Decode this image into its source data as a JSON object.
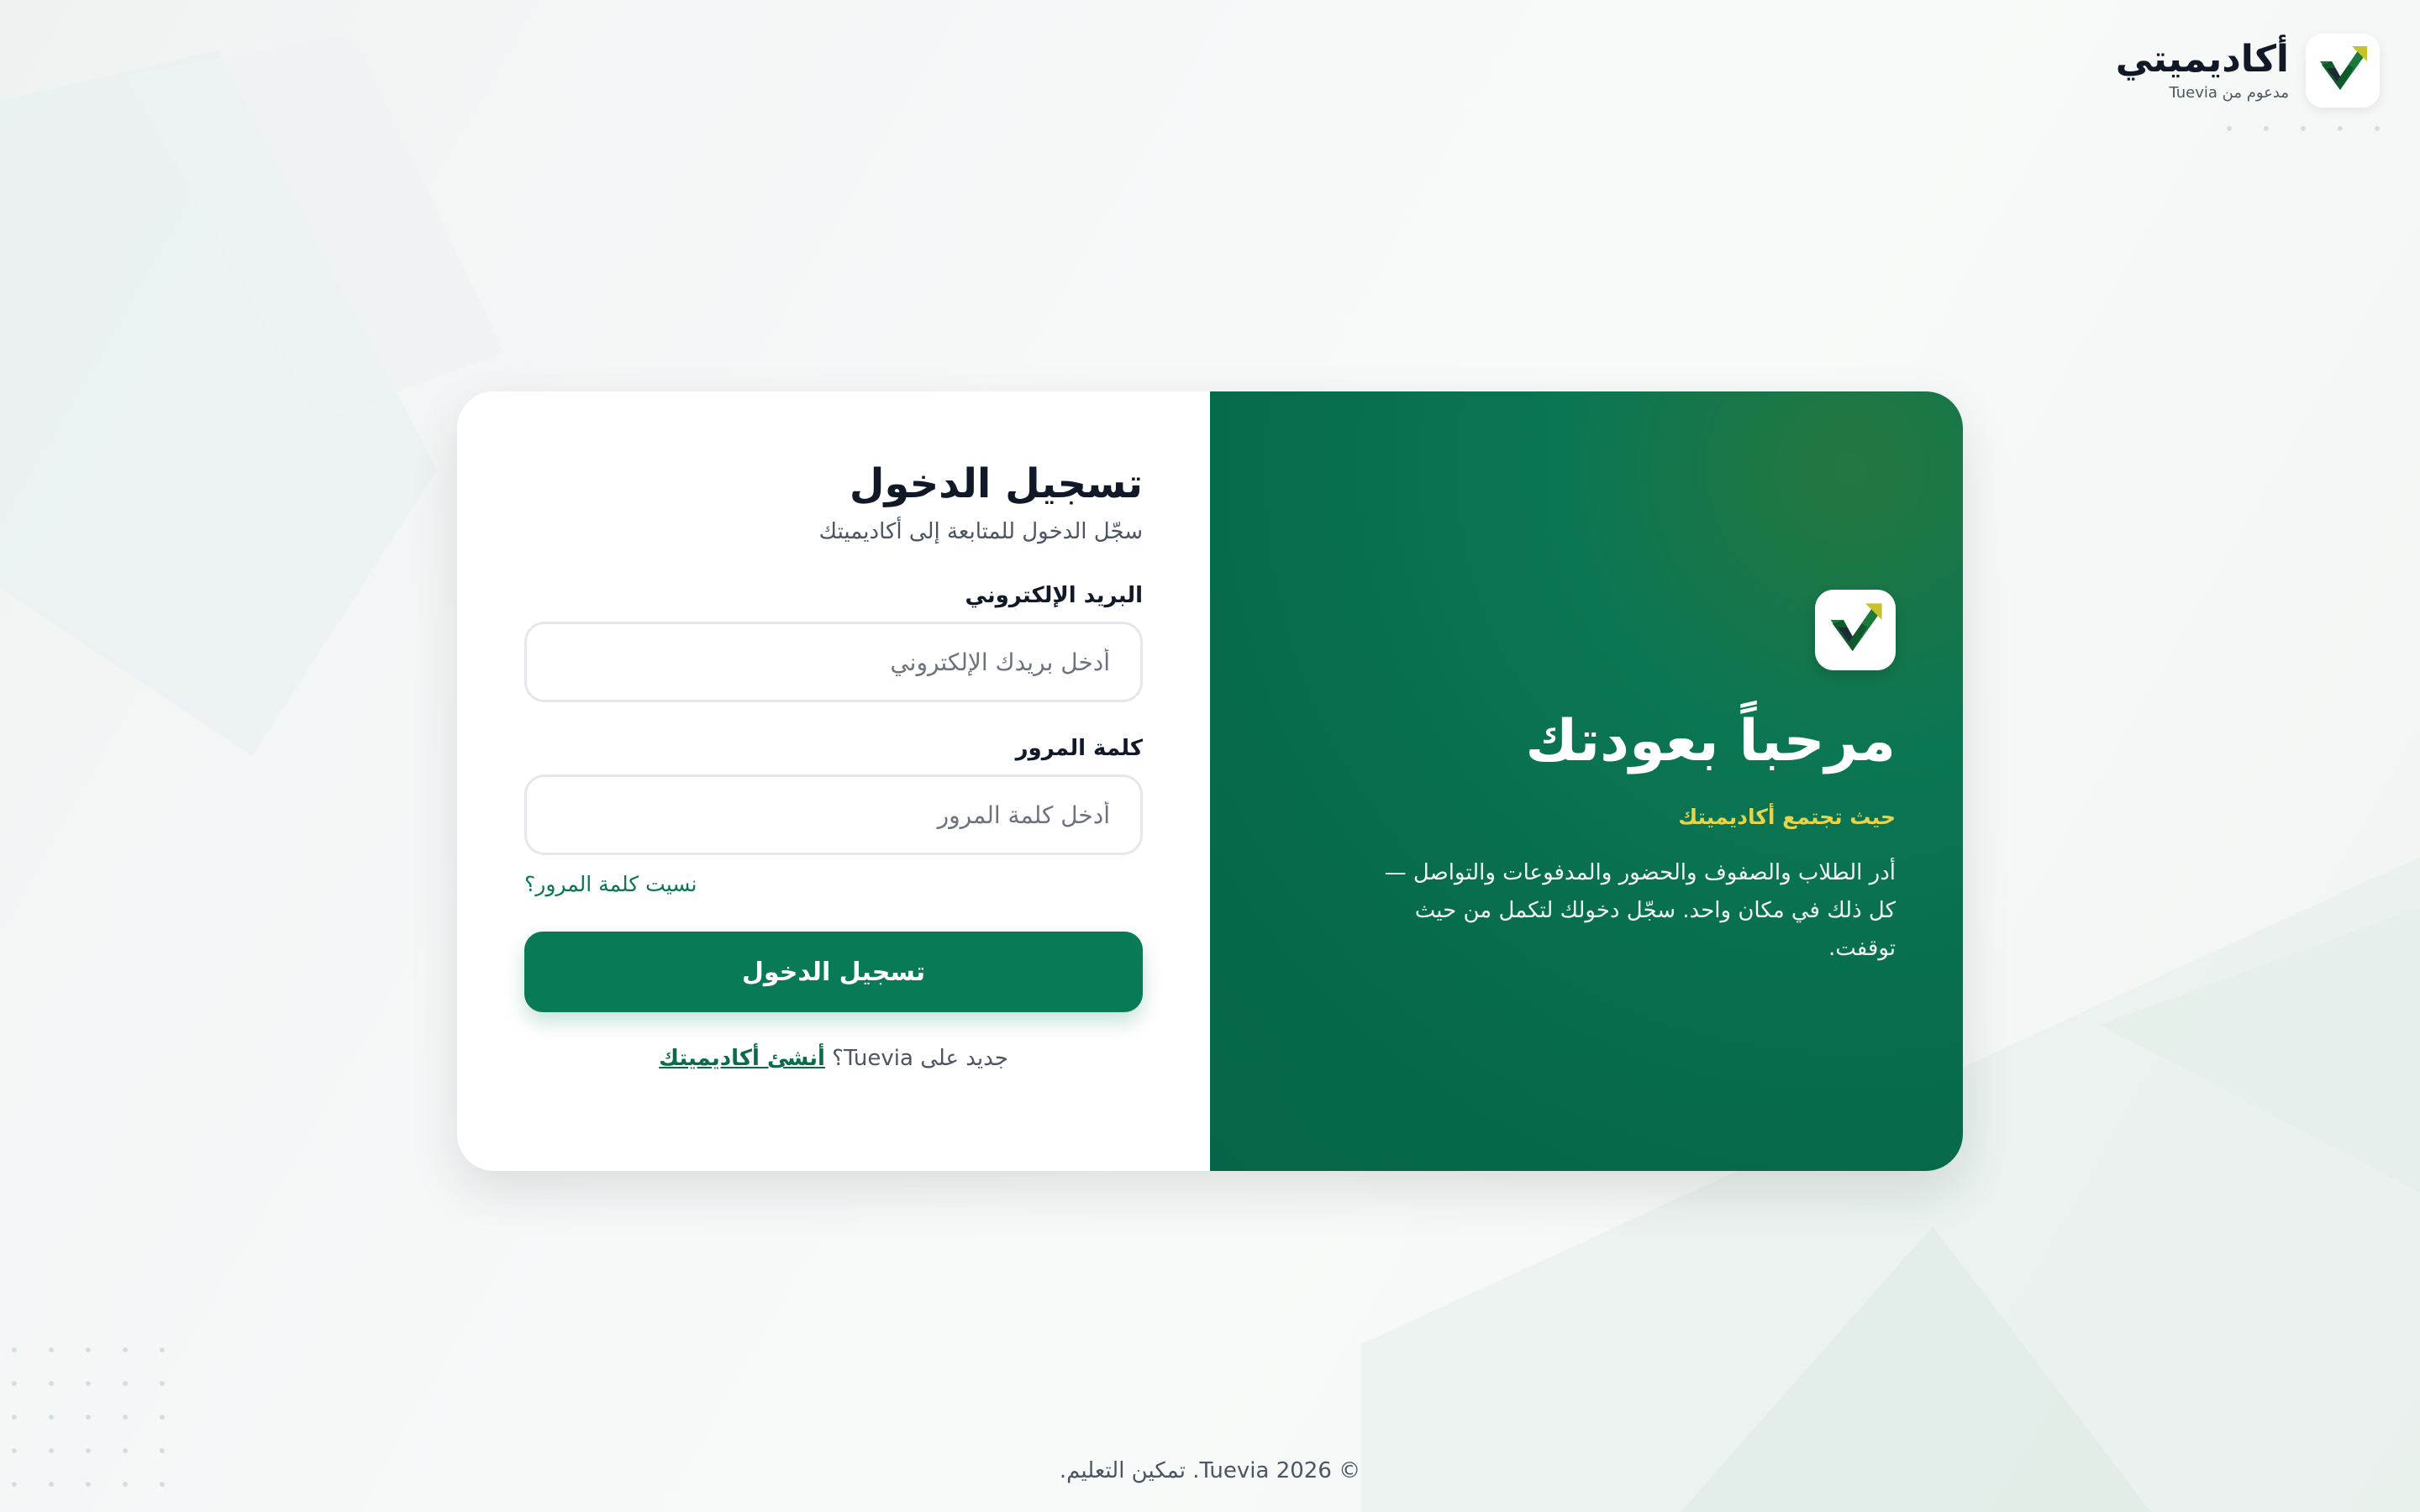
{
  "brand": {
    "name": "أكاديميتي",
    "powered_by": "مدعوم من Tuevia",
    "logo_icon": "academy-checkmark-logo-icon"
  },
  "welcome_panel": {
    "title": "مرحباً بعودتك",
    "tagline": "حيث تجتمع أكاديميتك",
    "description": "أدر الطلاب والصفوف والحضور والمدفوعات والتواصل — كل ذلك في مكان واحد. سجّل دخولك لتكمل من حيث توقفت.",
    "colors": {
      "panel_green": "#066a4b",
      "tagline_yellow": "#e7d44a"
    }
  },
  "login_form": {
    "title": "تسجيل الدخول",
    "subtitle": "سجّل الدخول للمتابعة إلى أكاديميتك",
    "email_label": "البريد الإلكتروني",
    "email_placeholder": "أدخل بريدك الإلكتروني",
    "email_value": "",
    "password_label": "كلمة المرور",
    "password_placeholder": "أدخل كلمة المرور",
    "password_value": "",
    "forgot_password": "نسيت كلمة المرور؟",
    "submit_label": "تسجيل الدخول",
    "signup_prompt": "جديد على Tuevia؟",
    "signup_link": "أنشئ أكاديميتك",
    "colors": {
      "primary": "#087a57"
    }
  },
  "footer": {
    "copyright": "© Tuevia 2026. تمكين التعليم."
  }
}
